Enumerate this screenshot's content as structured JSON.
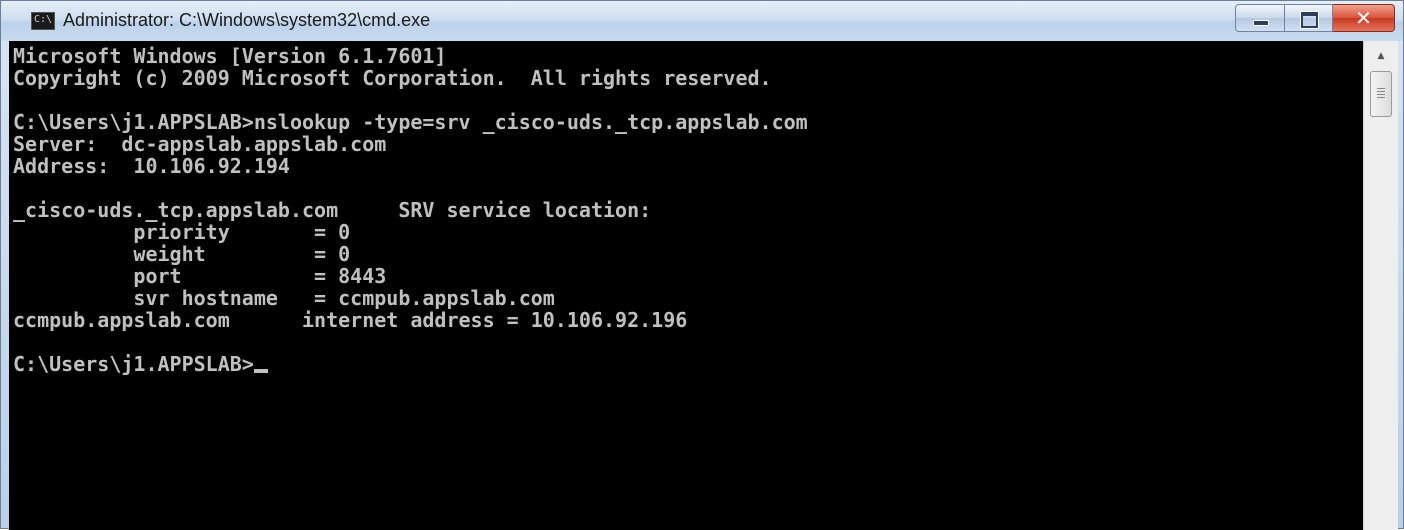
{
  "window": {
    "title": "Administrator: C:\\Windows\\system32\\cmd.exe",
    "icon": "cmd-icon",
    "icon_text": "C:\\",
    "controls": {
      "minimize": "minimize-icon",
      "maximize": "maximize-icon",
      "close_label": "✕"
    }
  },
  "console": {
    "lines": [
      "Microsoft Windows [Version 6.1.7601]",
      "Copyright (c) 2009 Microsoft Corporation.  All rights reserved.",
      "",
      "C:\\Users\\j1.APPSLAB>nslookup -type=srv _cisco-uds._tcp.appslab.com",
      "Server:  dc-appslab.appslab.com",
      "Address:  10.106.92.194",
      "",
      "_cisco-uds._tcp.appslab.com     SRV service location:",
      "          priority       = 0",
      "          weight         = 0",
      "          port           = 8443",
      "          svr hostname   = ccmpub.appslab.com",
      "ccmpub.appslab.com      internet address = 10.106.92.196",
      ""
    ],
    "prompt": "C:\\Users\\j1.APPSLAB>",
    "colors": {
      "background": "#000000",
      "foreground": "#c0c0c0"
    }
  },
  "scrollbar": {
    "up_arrow": "▲"
  }
}
